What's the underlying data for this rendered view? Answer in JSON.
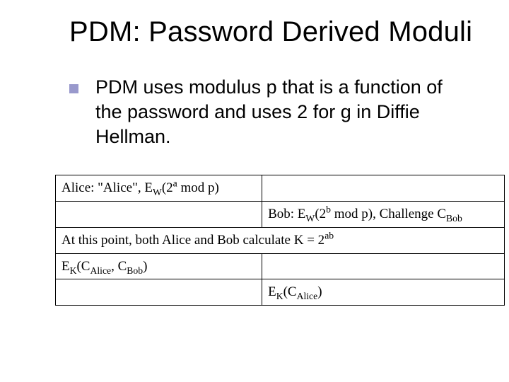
{
  "title": "PDM: Password Derived Moduli",
  "bullet": "PDM uses modulus p that is a function of the password and uses 2 for g in Diffie Hellman.",
  "protocol": {
    "row1_left_html": "Alice: \"Alice\", E<sub>W</sub>(2<sup>a</sup> mod p)",
    "row2_right_html": "Bob: E<sub>W</sub>(2<sup>b</sup> mod p), Challenge C<sub>Bob</sub>",
    "row3_full_html": "At this point, both Alice and Bob calculate K = 2<sup>ab</sup>",
    "row4_left_html": "E<sub>K</sub>(C<sub>Alice</sub>, C<sub>Bob</sub>)",
    "row5_right_html": "E<sub>K</sub>(C<sub>Alice</sub>)"
  }
}
